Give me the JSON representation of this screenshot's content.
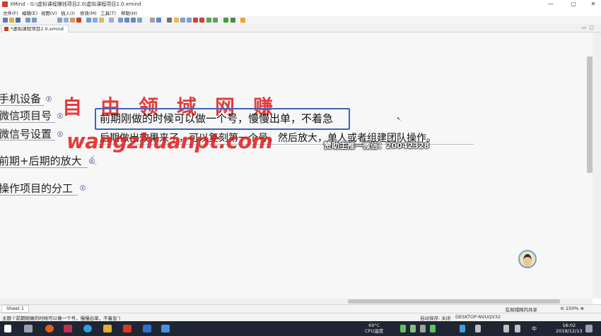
{
  "window": {
    "title": "XMind - G:\\虚拟课程赚钱项目2.0\\虚拟课程项目2.0.xmind",
    "controls": [
      "—",
      "▢",
      "✕"
    ]
  },
  "menu": {
    "items": [
      "文件(F)",
      "编辑(E)",
      "视图(V)",
      "插入(I)",
      "修改(M)",
      "工具(T)",
      "帮助(H)"
    ]
  },
  "editor_tab": {
    "label": "*虚拟课程项目2.0.xmind"
  },
  "canvas": {
    "topics": [
      "手机设备",
      "微信项目号",
      "微信号设置",
      "前期+后期的放大",
      "操作项目的分工"
    ],
    "selected_topic": "前期刚做的时候可以做一个号，慢慢出单，不着急",
    "note_topic": "后期做出效果来了，可以复刻第一个号，然后放大，单人或者组建团队操作。"
  },
  "watermarks": {
    "chinese": "自由领域网赚",
    "url": "wangzhuanpt.com",
    "contact": "赞助主推一微信：20042328"
  },
  "sheet_bar": {
    "sheet_tab": "Sheet 1",
    "lan_share": "在局域网内共享",
    "zoom": "150%"
  },
  "status_bar": {
    "left_text": "主题 (‘前期刚做的时候可以做一个号，慢慢出单，不着急’)",
    "autosave": "自动保存: 关闭",
    "computer": "DESKTOP-NVUQV32"
  },
  "taskbar": {
    "temperature": "69°C",
    "cpu_label": "CPU温度",
    "ime": "中",
    "time": "16:02",
    "date": "2019/12/13"
  },
  "colors": {
    "selection_border": "#3e64b8",
    "watermark": "#e21a1a",
    "taskbar": "#1e2634"
  }
}
